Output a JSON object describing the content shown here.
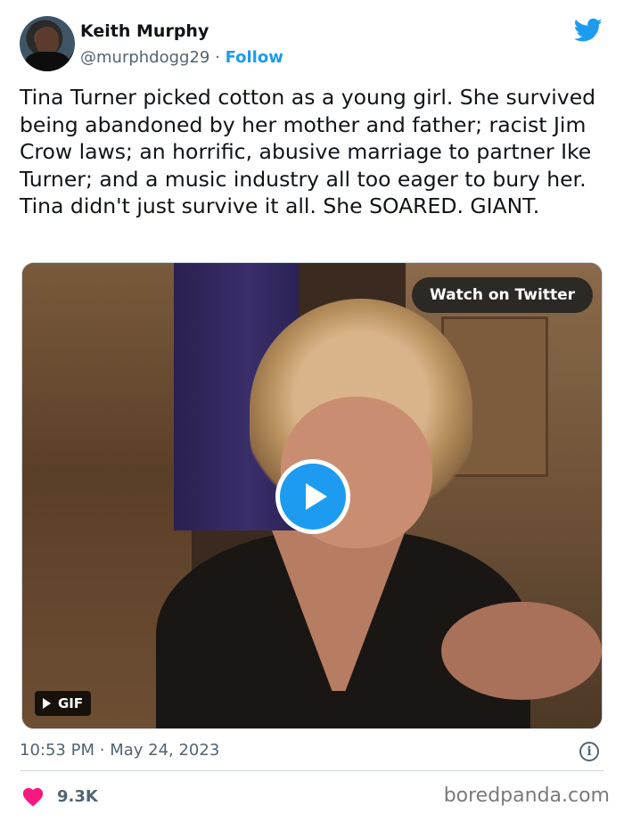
{
  "author": {
    "name": "Keith Murphy",
    "handle": "@murphdogg29",
    "separator": "·",
    "follow_label": "Follow"
  },
  "tweet": {
    "text": "Tina Turner picked cotton as a young girl. She survived being abandoned by her mother and father; racist Jim Crow laws; an horrific, abusive marriage to partner Ike Turner; and a music industry all too eager to bury her.   Tina didn't just survive it all. She SOARED. GIANT."
  },
  "media": {
    "watch_label": "Watch on Twitter",
    "gif_label": "GIF"
  },
  "meta": {
    "time": "10:53 PM",
    "separator": "·",
    "date": "May 24, 2023",
    "info_glyph": "i"
  },
  "engagement": {
    "likes": "9.3K"
  },
  "watermark": "boredpanda.com",
  "colors": {
    "accent": "#1d9bf0",
    "like": "#f91880",
    "text_secondary": "#536471"
  },
  "icons": [
    "twitter-bird-icon",
    "play-icon",
    "gif-play-icon",
    "info-icon",
    "heart-icon"
  ]
}
